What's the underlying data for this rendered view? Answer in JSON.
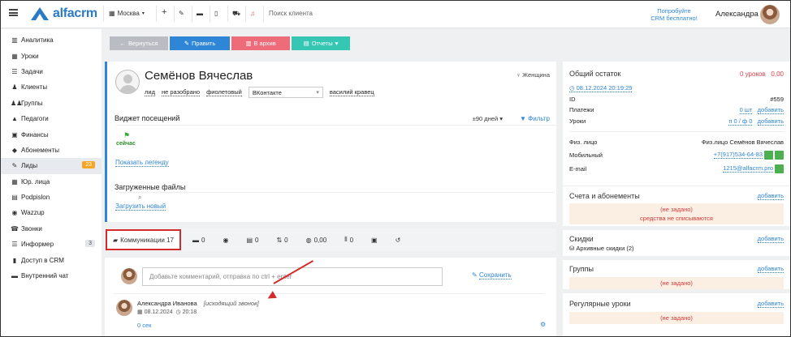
{
  "topbar": {
    "logo": "alfacrm",
    "city": "Москва",
    "search_placeholder": "Поиск клиента",
    "try_line1": "Попробуйте",
    "try_line2": "CRM бесплатно!",
    "user_name": "Александра",
    "icons": [
      "menu-icon",
      "plus-icon",
      "wrench-icon",
      "card-icon",
      "phone-icon",
      "cart-icon",
      "bell-icon"
    ]
  },
  "sidebar": {
    "items": [
      {
        "label": "Аналитика",
        "icon": "chart-icon"
      },
      {
        "label": "Уроки",
        "icon": "calendar-icon"
      },
      {
        "label": "Задачи",
        "icon": "list-icon"
      },
      {
        "label": "Клиенты",
        "icon": "user-icon"
      },
      {
        "label": "Группы",
        "icon": "users-icon"
      },
      {
        "label": "Педагоги",
        "icon": "graduation-icon"
      },
      {
        "label": "Финансы",
        "icon": "money-icon"
      },
      {
        "label": "Абонементы",
        "icon": "tag-icon"
      },
      {
        "label": "Лиды",
        "icon": "lead-icon",
        "badge": "23",
        "active": true
      },
      {
        "label": "Юр. лица",
        "icon": "building-icon"
      },
      {
        "label": "Podpislon",
        "icon": "doc-icon"
      },
      {
        "label": "Wazzup",
        "icon": "chat-icon"
      },
      {
        "label": "Звонки",
        "icon": "call-icon"
      },
      {
        "label": "Информер",
        "icon": "list-icon",
        "badge": "3"
      },
      {
        "label": "Доступ в CRM",
        "icon": "lock-icon"
      },
      {
        "label": "Внутренний чат",
        "icon": "message-icon"
      }
    ]
  },
  "buttons": {
    "back": "Вернуться",
    "edit": "Править",
    "archive": "В архив",
    "reports": "Отчеты"
  },
  "card": {
    "name": "Семёнов Вячеслав",
    "gender": "Женщина",
    "tags": [
      "лид",
      "не разобрано",
      "фиолетовый"
    ],
    "source": "ВКонтакте",
    "manager": "василий кравец",
    "visits_title": "Виджет посещений",
    "days": "±90 дней",
    "filter": "Фильтр",
    "now": "сейчас",
    "legend": "Показать легенду",
    "files_title": "Загруженные файлы",
    "upload": "Загрузить новый"
  },
  "tabs": {
    "comm": "Коммуникации 17",
    "msg": "0",
    "calls": "0",
    "docs": "0",
    "ops": "0",
    "money": "0,00",
    "lessons": "0"
  },
  "comment": {
    "placeholder": "Добавьте комментарий, отправка по ctrl + enter",
    "save": "Сохранить",
    "author": "Александра Иванова",
    "type": "[исходящий звонок]",
    "date": "08.12.2024",
    "time": "20:18",
    "duration": "0 сек"
  },
  "right": {
    "balance_title": "Общий остаток",
    "balance_lessons": "0 уроков",
    "balance_money": "0,00",
    "date": "08.12.2024 20:19:29",
    "id_label": "ID",
    "id_value": "#559",
    "payments_label": "Платежи",
    "payments_value": "0 шт",
    "lessons_label": "Уроки",
    "lessons_value": "п 0 / ф 0",
    "add": "добавить",
    "person_label": "Физ. лицо",
    "person_value": "Физ.лицо Семёнов Вячеслав",
    "mobile_label": "Мобильный",
    "mobile_value": "+7(917)534-64-83",
    "email_label": "E-mail",
    "email_value": "1215@alfacrm.pro",
    "accounts_title": "Счета и абонементы",
    "not_set": "(не задано)",
    "no_charge": "средства не списываются",
    "discounts_title": "Скидки",
    "archive_discounts": "Архивные скидки (2)",
    "groups_title": "Группы",
    "regular_title": "Регулярные уроки"
  }
}
